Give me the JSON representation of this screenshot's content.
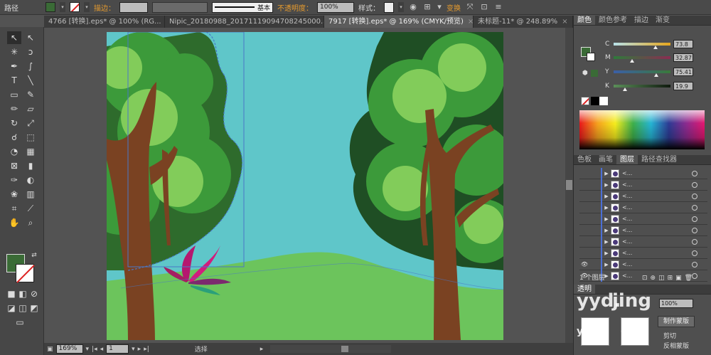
{
  "control_bar": {
    "object_type": "路径",
    "stroke_label": "描边：",
    "stroke_profile": "基本",
    "opacity_label": "不透明度：",
    "opacity_value": "100%",
    "style_label": "样式：",
    "transform_label": "变换",
    "fill_color": "#3a6b36"
  },
  "tabs": [
    {
      "label": "4766 [转换].eps* @ 100% (RG..."
    },
    {
      "label": "Nipic_20180988_20171119094708245000.ai*"
    },
    {
      "label": "7917 [转换].eps* @ 169% (CMYK/预览)"
    },
    {
      "label": "未标题-11* @ 248.89%"
    }
  ],
  "tab_close": "×",
  "status_bar": {
    "zoom": "169%",
    "page": "1",
    "tool_name": "选择"
  },
  "color_panel": {
    "tabs": [
      "颜色",
      "颜色参考",
      "描边",
      "渐变"
    ],
    "active_tab": "颜色",
    "channels": [
      {
        "key": "C",
        "value": "73.8",
        "fraction": 0.738,
        "grad_from": "#b7e1e9",
        "grad_to": "#e5a61c"
      },
      {
        "key": "M",
        "value": "32.87",
        "fraction": 0.3287,
        "grad_from": "#2f7a3b",
        "grad_to": "#8a2d52"
      },
      {
        "key": "Y",
        "value": "75.41",
        "fraction": 0.7541,
        "grad_from": "#3b5fa7",
        "grad_to": "#3a7a3a"
      },
      {
        "key": "K",
        "value": "19.9",
        "fraction": 0.199,
        "grad_from": "#5b8f59",
        "grad_to": "#0f1a0e"
      }
    ]
  },
  "layers_panel": {
    "tabs": [
      "色板",
      "画笔",
      "图层",
      "路径查找器"
    ],
    "active_tab": "图层",
    "rows": [
      {
        "name": "<...",
        "visible": false
      },
      {
        "name": "<...",
        "visible": false
      },
      {
        "name": "<...",
        "visible": false
      },
      {
        "name": "<...",
        "visible": false
      },
      {
        "name": "<...",
        "visible": false
      },
      {
        "name": "<...",
        "visible": false
      },
      {
        "name": "<...",
        "visible": false
      },
      {
        "name": "<...",
        "visible": false
      },
      {
        "name": "<...",
        "visible": true
      },
      {
        "name": "<...",
        "visible": true
      }
    ],
    "footer_count": "1 个图层"
  },
  "transparency_panel": {
    "tab": "透明",
    "opacity_value": "100%",
    "make_mask_button": "制作蒙版",
    "clip_label": "剪切",
    "invert_label": "反相蒙版"
  },
  "watermark": {
    "line1": "yyd.",
    "line2": "jing",
    "site": "yan.d",
    "site2": "oc"
  },
  "colors": {
    "sky": "#5fc6c9",
    "grass": "#6cc45c",
    "trunk": "#7a4222",
    "leaf_dark": "#2e6b2c",
    "leaf_mid": "#3c9a3a",
    "leaf_light": "#8ad25e",
    "selection": "#4a78c8"
  }
}
